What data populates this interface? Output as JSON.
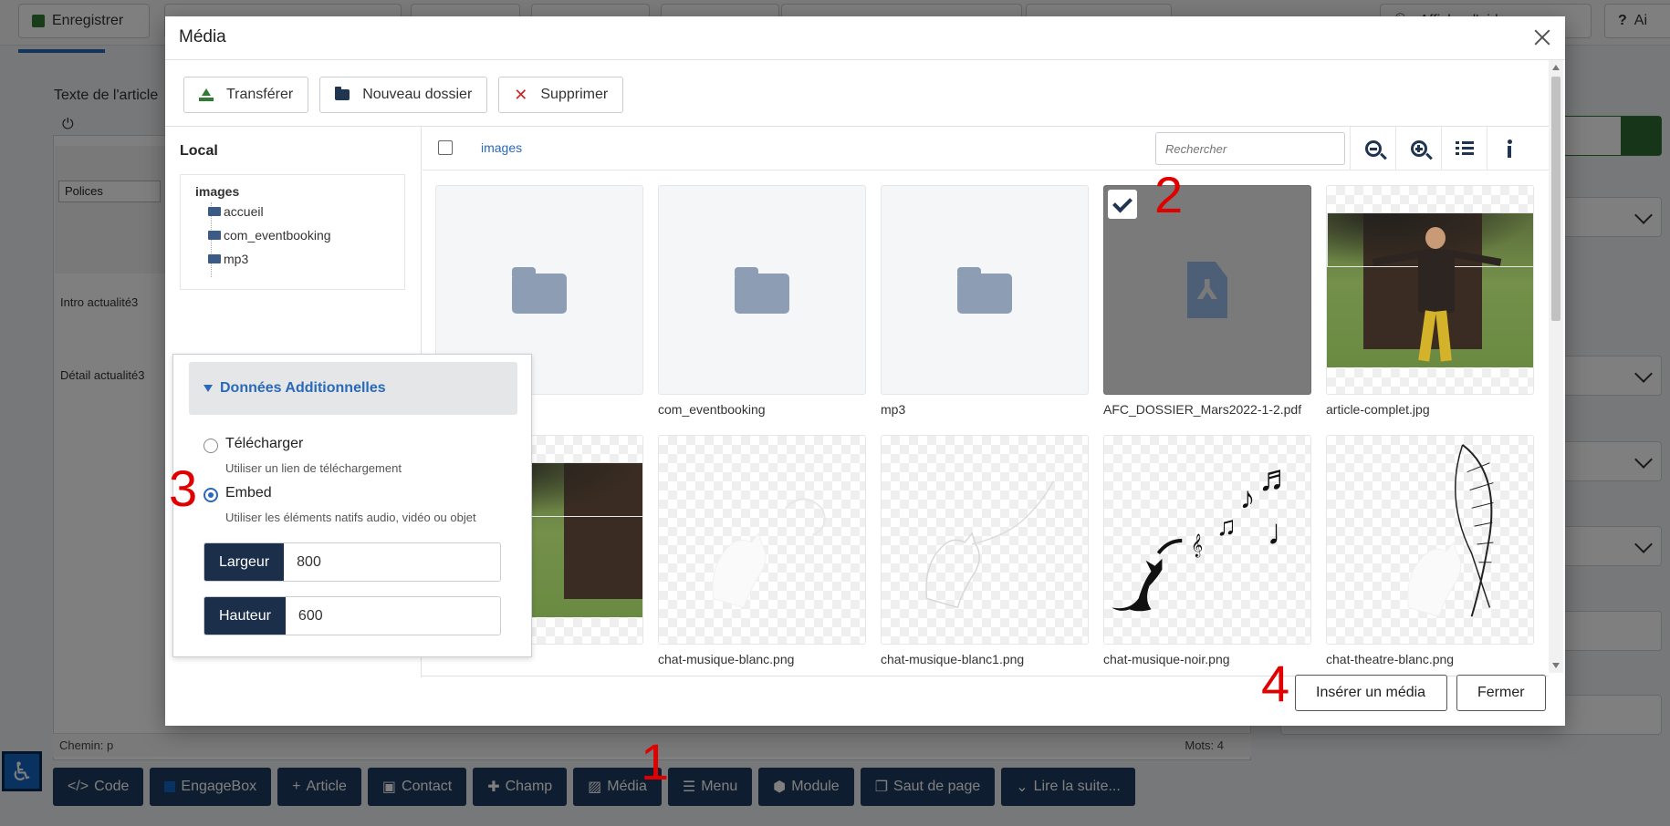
{
  "background": {
    "toolbar": {
      "save_label": "Enregistrer",
      "help_label": "Afficher l'aide",
      "help_partial": "Ai"
    },
    "editor": {
      "field_label": "Texte de l'article",
      "font_select": "Polices",
      "line1": "Intro actualité3",
      "line2": "Détail actualité3",
      "path_label": "Chemin: p",
      "words_label": "Mots: 4"
    },
    "bottom_buttons": [
      {
        "icon": "code-icon",
        "label": "Code"
      },
      {
        "icon": "engagebox-icon",
        "label": "EngageBox"
      },
      {
        "icon": "plus-icon",
        "label": "Article"
      },
      {
        "icon": "contact-icon",
        "label": "Contact"
      },
      {
        "icon": "puzzle-icon",
        "label": "Champ"
      },
      {
        "icon": "image-icon",
        "label": "Média"
      },
      {
        "icon": "list-icon",
        "label": "Menu"
      },
      {
        "icon": "cube-icon",
        "label": "Module"
      },
      {
        "icon": "copy-icon",
        "label": "Saut de page"
      },
      {
        "icon": "chevron-down-icon",
        "label": "Lire la suite..."
      }
    ]
  },
  "modal": {
    "title": "Média",
    "actions": {
      "upload": "Transférer",
      "new_folder": "Nouveau dossier",
      "delete": "Supprimer"
    },
    "sidebar": {
      "title": "Local",
      "root": "images",
      "folders": [
        "accueil",
        "com_eventbooking",
        "mp3"
      ]
    },
    "breadcrumb": "images",
    "search_placeholder": "Rechercher",
    "items": [
      {
        "name": "",
        "kind": "folder"
      },
      {
        "name": "com_eventbooking",
        "kind": "folder"
      },
      {
        "name": "mp3",
        "kind": "folder"
      },
      {
        "name": "AFC_DOSSIER_Mars2022-1-2.pdf",
        "kind": "pdf",
        "selected": true
      },
      {
        "name": "article-complet.jpg",
        "kind": "photo"
      },
      {
        "name": "",
        "kind": "photo"
      },
      {
        "name": "chat-musique-blanc.png",
        "kind": "png-white"
      },
      {
        "name": "chat-musique-blanc1.png",
        "kind": "png-white"
      },
      {
        "name": "chat-musique-noir.png",
        "kind": "png-black"
      },
      {
        "name": "chat-theatre-blanc.png",
        "kind": "png-feather"
      }
    ],
    "additional": {
      "heading": "Données Additionnelles",
      "options": [
        {
          "label": "Télécharger",
          "help": "Utiliser un lien de téléchargement",
          "checked": false
        },
        {
          "label": "Embed",
          "help": "Utiliser les éléments natifs audio, vidéo ou objet",
          "checked": true
        }
      ],
      "width_label": "Largeur",
      "width_value": "800",
      "height_label": "Hauteur",
      "height_value": "600"
    },
    "footer": {
      "insert": "Insérer un média",
      "close": "Fermer"
    }
  },
  "annotations": [
    "1",
    "2",
    "3",
    "4"
  ]
}
